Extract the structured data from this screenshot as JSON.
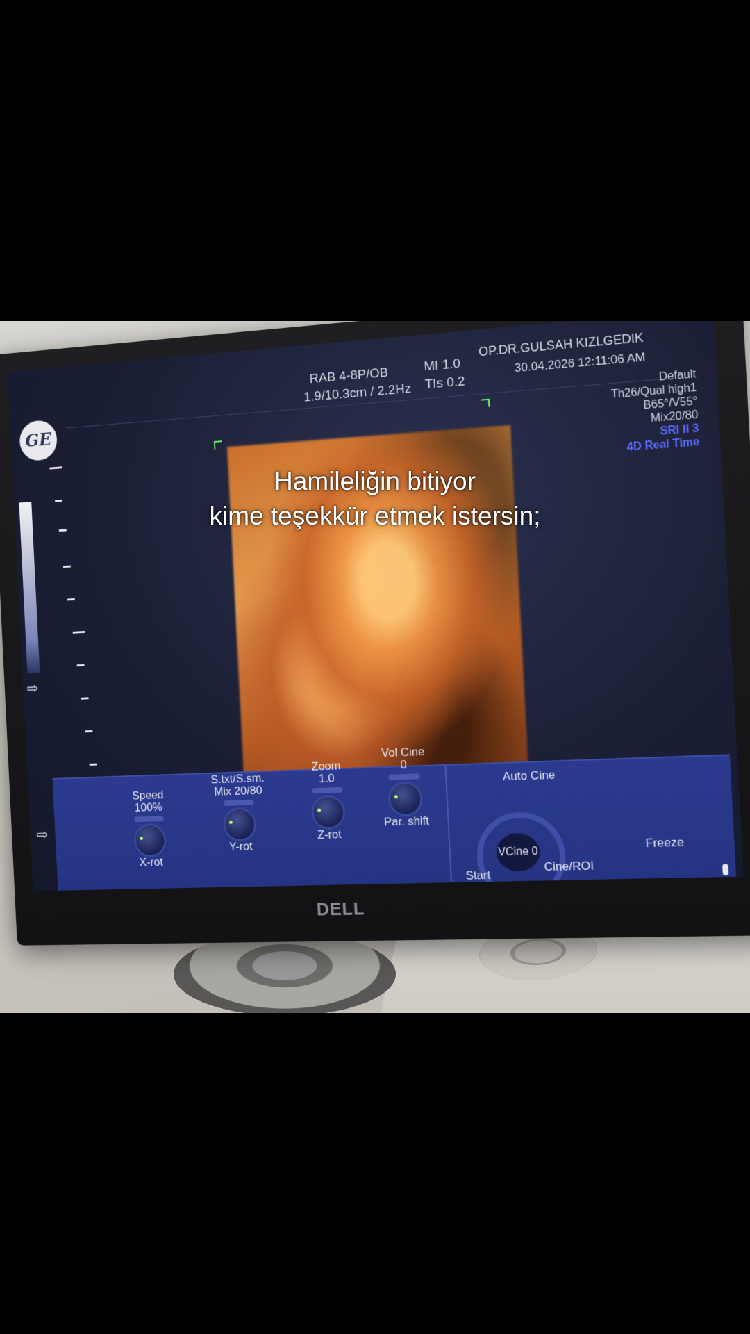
{
  "caption": {
    "line1": "Hamileliğin bitiyor",
    "line2": "kime teşekkür etmek istersin;"
  },
  "ultrasound": {
    "probe": "RAB 4-8P/OB",
    "depth_freq": "1.9/10.3cm / 2.2Hz",
    "mi": "MI  1.0",
    "tis": "TIs  0.2",
    "operator": "OP.DR.GULSAH KIZLGEDIK",
    "datetime": "30.04.2026  12:11:06 AM",
    "right_info": [
      "Default",
      "Th26/Qual high1",
      "B65°/V55°",
      "Mix20/80"
    ],
    "right_info_blue": [
      "SRI II 3",
      "4D Real Time"
    ]
  },
  "controls": {
    "speed_label": "Speed",
    "speed_value": "100%",
    "x_rot": "X-rot",
    "stxt_label": "S.txt/S.sm.",
    "stxt_value": "Mix 20/80",
    "y_rot": "Y-rot",
    "zoom_label": "Zoom",
    "zoom_value": "1.0",
    "z_rot": "Z-rot",
    "volcine_label": "Vol Cine",
    "volcine_value": "0",
    "par_shift": "Par. shift",
    "auto_cine": "Auto Cine",
    "vcine": "VCine 0",
    "start": "Start",
    "cine_roi": "Cine/ROI",
    "freeze": "Freeze"
  },
  "monitor_brand": "DELL",
  "logo_text": "GE"
}
